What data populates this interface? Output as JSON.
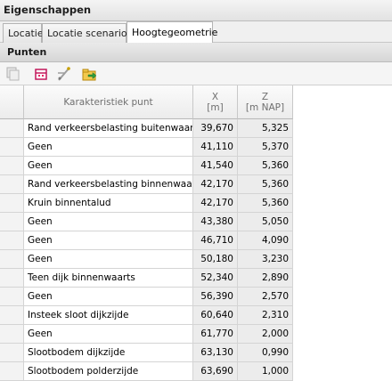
{
  "panel": {
    "title": "Eigenschappen"
  },
  "tabs": [
    {
      "label": "Locatie"
    },
    {
      "label": "Locatie scenario's"
    },
    {
      "label": "Hoogtegeometrie"
    }
  ],
  "section": {
    "title": "Punten"
  },
  "toolbar": {
    "buttons": [
      {
        "icon": "copy-icon"
      },
      {
        "icon": "import-points-icon"
      },
      {
        "icon": "edit-geometry-icon"
      },
      {
        "icon": "export-icon"
      }
    ]
  },
  "table": {
    "headers": {
      "name": "Karakteristiek punt",
      "x": "X",
      "x_unit": "[m]",
      "z": "Z",
      "z_unit": "[m NAP]"
    },
    "rows": [
      {
        "name": "Rand verkeersbelasting buitenwaarts",
        "x": "39,670",
        "z": "5,325"
      },
      {
        "name": "Geen",
        "x": "41,110",
        "z": "5,370"
      },
      {
        "name": "Geen",
        "x": "41,540",
        "z": "5,360"
      },
      {
        "name": "Rand verkeersbelasting binnenwaarts",
        "x": "42,170",
        "z": "5,360"
      },
      {
        "name": "Kruin binnentalud",
        "x": "42,170",
        "z": "5,360"
      },
      {
        "name": "Geen",
        "x": "43,380",
        "z": "5,050"
      },
      {
        "name": "Geen",
        "x": "46,710",
        "z": "4,090"
      },
      {
        "name": "Geen",
        "x": "50,180",
        "z": "3,230"
      },
      {
        "name": "Teen dijk binnenwaarts",
        "x": "52,340",
        "z": "2,890"
      },
      {
        "name": "Geen",
        "x": "56,390",
        "z": "2,570"
      },
      {
        "name": "Insteek sloot dijkzijde",
        "x": "60,640",
        "z": "2,310"
      },
      {
        "name": "Geen",
        "x": "61,770",
        "z": "2,000"
      },
      {
        "name": "Slootbodem dijkzijde",
        "x": "63,130",
        "z": "0,990"
      },
      {
        "name": "Slootbodem polderzijde",
        "x": "63,690",
        "z": "1,000"
      }
    ]
  }
}
